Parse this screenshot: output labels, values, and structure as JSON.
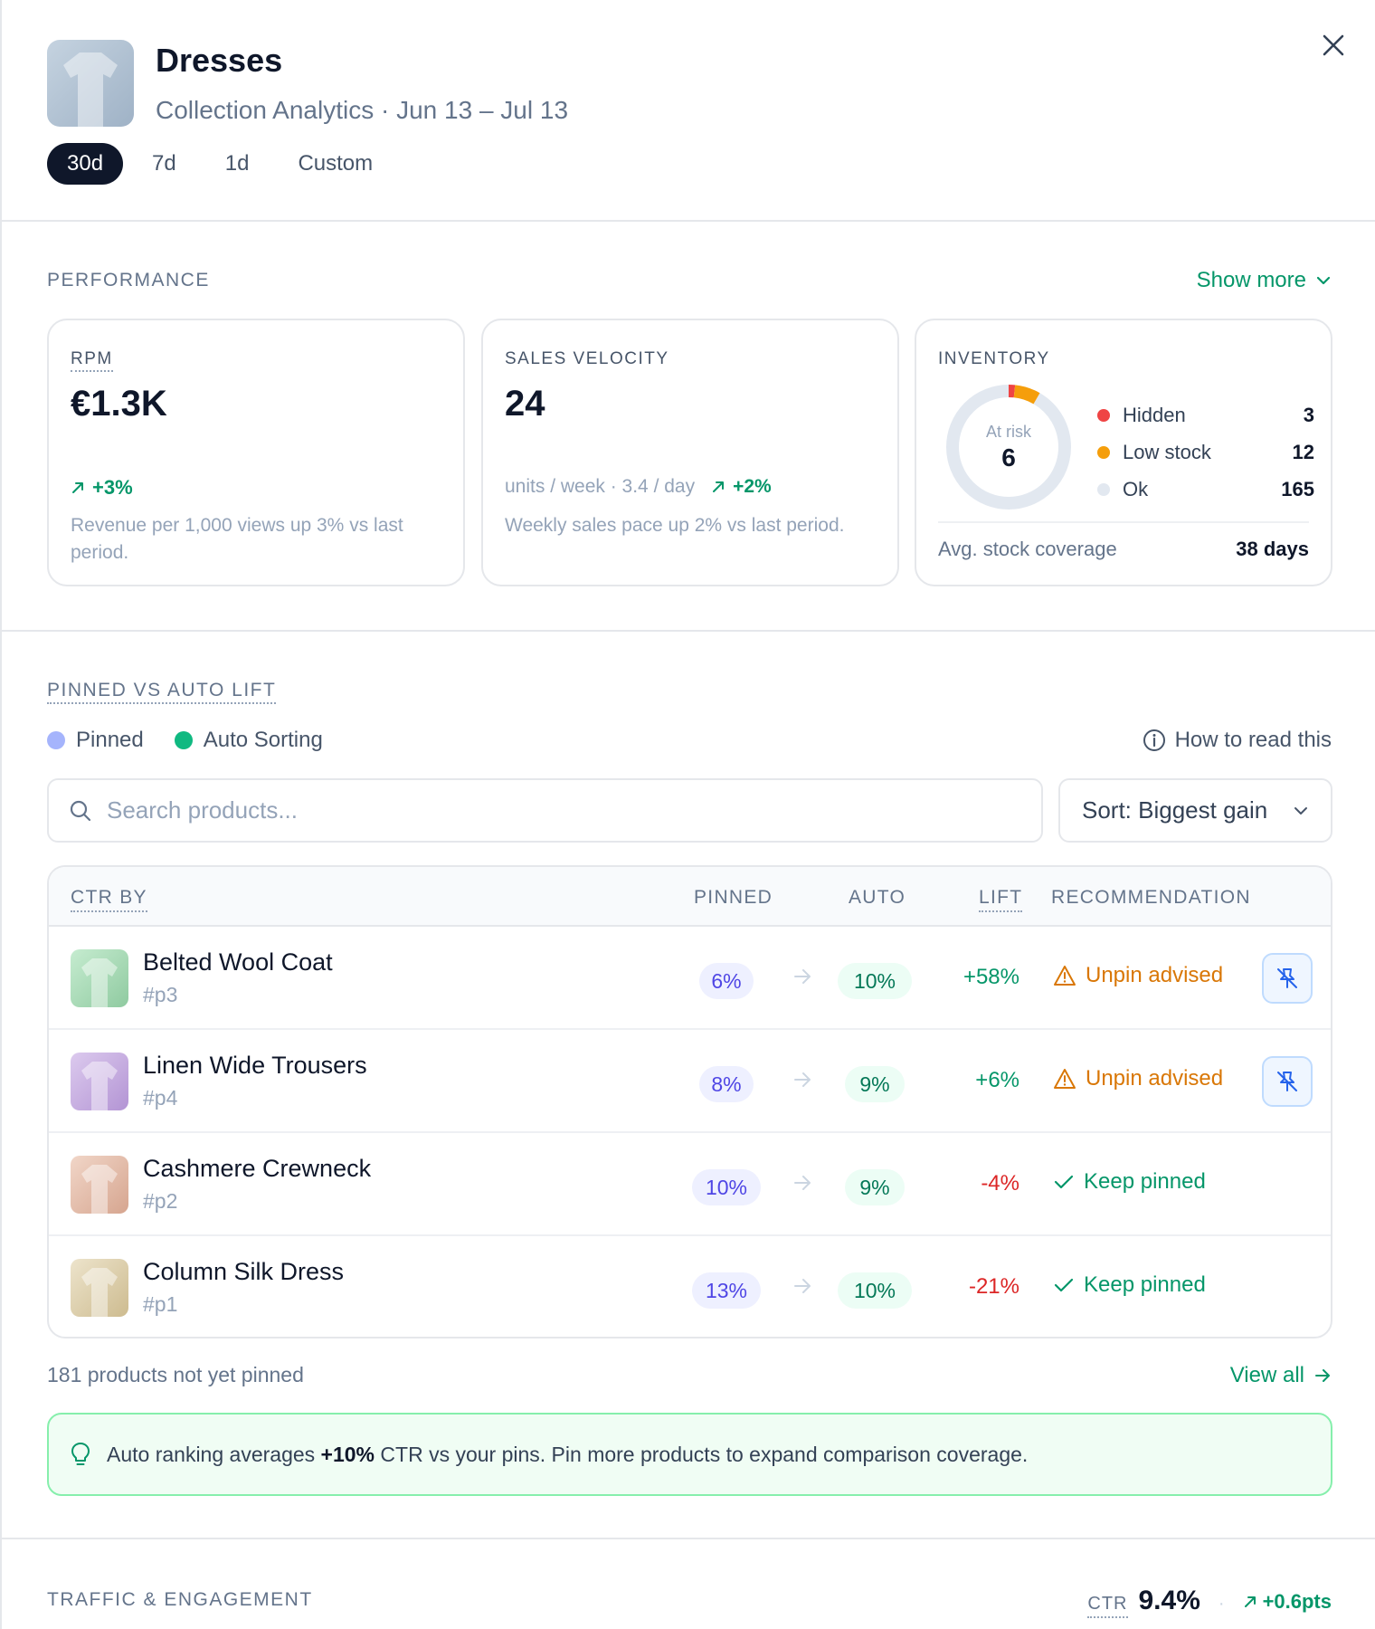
{
  "header": {
    "title": "Dresses",
    "subtitle": "Collection Analytics · Jun 13 – Jul 13",
    "range_tabs": [
      "30d",
      "7d",
      "1d",
      "Custom"
    ],
    "active_range": "30d"
  },
  "performance": {
    "section_label": "PERFORMANCE",
    "show_more": "Show more",
    "rpm": {
      "label": "RPM",
      "value": "€1.3K",
      "delta": "+3%",
      "description": "Revenue per 1,000 views up 3% vs last period."
    },
    "velocity": {
      "label": "SALES VELOCITY",
      "value": "24",
      "sub": "units / week · 3.4 / day",
      "delta": "+2%",
      "description": "Weekly sales pace up 2% vs last period."
    },
    "inventory": {
      "label": "INVENTORY",
      "donut_label": "At risk",
      "donut_value": "6",
      "legend": [
        {
          "name": "Hidden",
          "count": "3",
          "value": 3,
          "color": "#ef4444"
        },
        {
          "name": "Low stock",
          "count": "12",
          "value": 12,
          "color": "#f59e0b"
        },
        {
          "name": "Ok",
          "count": "165",
          "value": 165,
          "color": "#e2e8f0"
        }
      ],
      "footer_label": "Avg. stock coverage",
      "footer_value": "38 days"
    }
  },
  "lift": {
    "section_label": "PINNED VS AUTO LIFT",
    "legend": [
      {
        "name": "Pinned",
        "color": "#a5b4fc"
      },
      {
        "name": "Auto Sorting",
        "color": "#10b981"
      }
    ],
    "how_to": "How to read this",
    "search_placeholder": "Search products...",
    "sort_label": "Sort: Biggest gain",
    "columns": {
      "ctr_by": "CTR BY",
      "pinned": "PINNED",
      "auto": "AUTO",
      "lift": "LIFT",
      "recommendation": "RECOMMENDATION"
    },
    "rows": [
      {
        "name": "Belted Wool Coat",
        "id": "#p3",
        "pinned": "6%",
        "auto": "10%",
        "lift": "+58%",
        "rec": "Unpin advised",
        "thumb": "#a9d9b5"
      },
      {
        "name": "Linen Wide Trousers",
        "id": "#p4",
        "pinned": "8%",
        "auto": "9%",
        "lift": "+6%",
        "rec": "Unpin advised",
        "thumb": "#c9b2de"
      },
      {
        "name": "Cashmere Crewneck",
        "id": "#p2",
        "pinned": "10%",
        "auto": "9%",
        "lift": "-4%",
        "rec": "Keep pinned",
        "thumb": "#e7c1b0"
      },
      {
        "name": "Column Silk Dress",
        "id": "#p1",
        "pinned": "13%",
        "auto": "10%",
        "lift": "-21%",
        "rec": "Keep pinned",
        "thumb": "#e1d5b7"
      }
    ],
    "not_pinned": "181 products not yet pinned",
    "view_all": "View all",
    "tip_before": "Auto ranking averages ",
    "tip_bold": "+10%",
    "tip_after": " CTR vs your pins. Pin more products to expand comparison coverage."
  },
  "traffic": {
    "section_label": "TRAFFIC & ENGAGEMENT",
    "ctr_label": "CTR",
    "ctr_value": "9.4%",
    "ctr_delta": "+0.6pts"
  }
}
